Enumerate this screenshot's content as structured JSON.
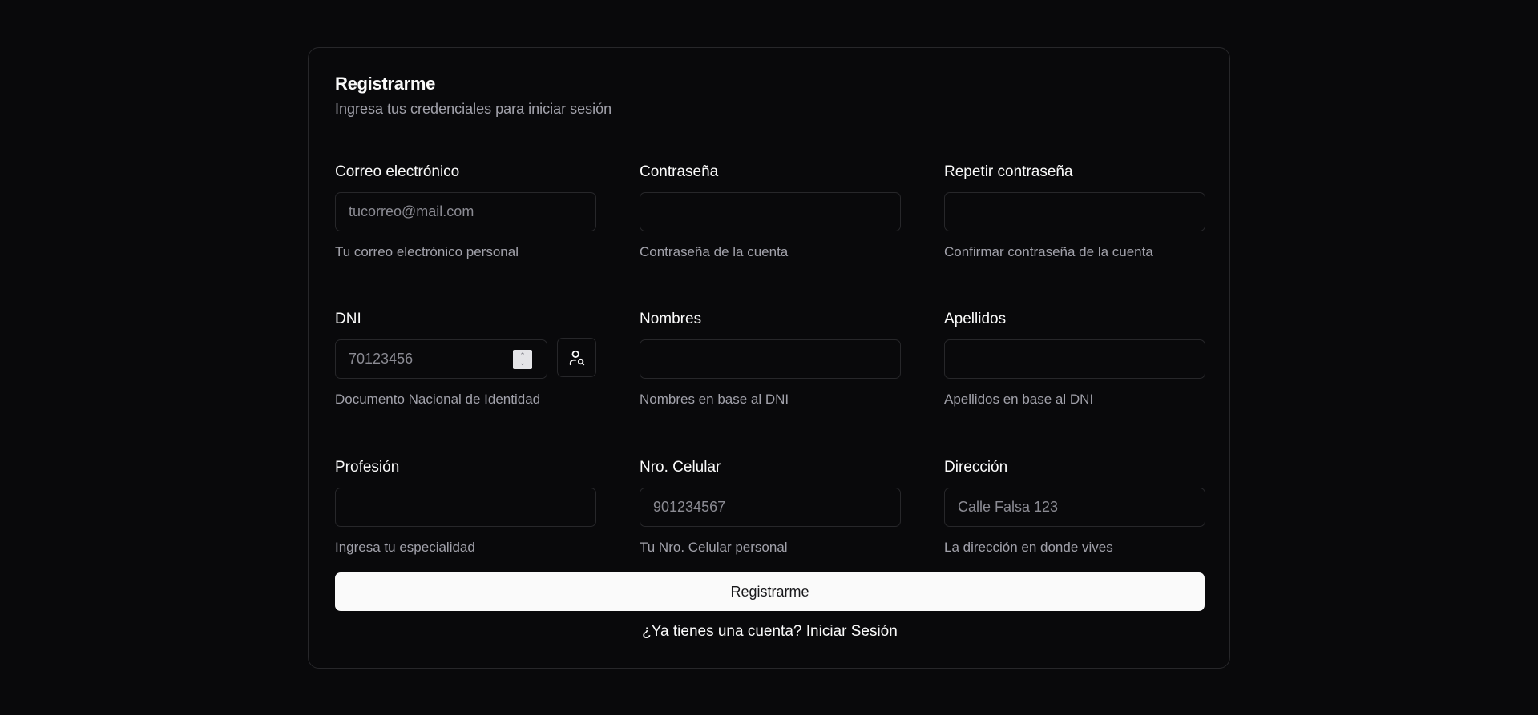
{
  "card": {
    "title": "Registrarme",
    "description": "Ingresa tus credenciales para iniciar sesión"
  },
  "fields": {
    "email": {
      "label": "Correo electrónico",
      "placeholder": "tucorreo@mail.com",
      "value": "",
      "help": "Tu correo electrónico personal"
    },
    "password": {
      "label": "Contraseña",
      "placeholder": "",
      "value": "",
      "help": "Contraseña de la cuenta"
    },
    "repeat_password": {
      "label": "Repetir contraseña",
      "placeholder": "",
      "value": "",
      "help": "Confirmar contraseña de la cuenta"
    },
    "dni": {
      "label": "DNI",
      "placeholder": "70123456",
      "value": "",
      "help": "Documento Nacional de Identidad"
    },
    "nombres": {
      "label": "Nombres",
      "placeholder": "",
      "value": "",
      "help": "Nombres en base al DNI"
    },
    "apellidos": {
      "label": "Apellidos",
      "placeholder": "",
      "value": "",
      "help": "Apellidos en base al DNI"
    },
    "profesion": {
      "label": "Profesión",
      "placeholder": "",
      "value": "",
      "help": "Ingresa tu especialidad"
    },
    "celular": {
      "label": "Nro. Celular",
      "placeholder": "901234567",
      "value": "",
      "help": "Tu Nro. Celular personal"
    },
    "direccion": {
      "label": "Dirección",
      "placeholder": "Calle Falsa 123",
      "value": "",
      "help": "La dirección en donde vives"
    }
  },
  "dni_lookup": {
    "icon": "user-search-icon"
  },
  "actions": {
    "submit_label": "Registrarme",
    "login_prompt": "¿Ya tienes una cuenta?",
    "login_link": "Iniciar Sesión"
  },
  "colors": {
    "background": "#09090b",
    "border": "#27272a",
    "text": "#fafafa",
    "muted": "#a1a1aa",
    "button_bg": "#fafafa",
    "button_text": "#18181b"
  }
}
